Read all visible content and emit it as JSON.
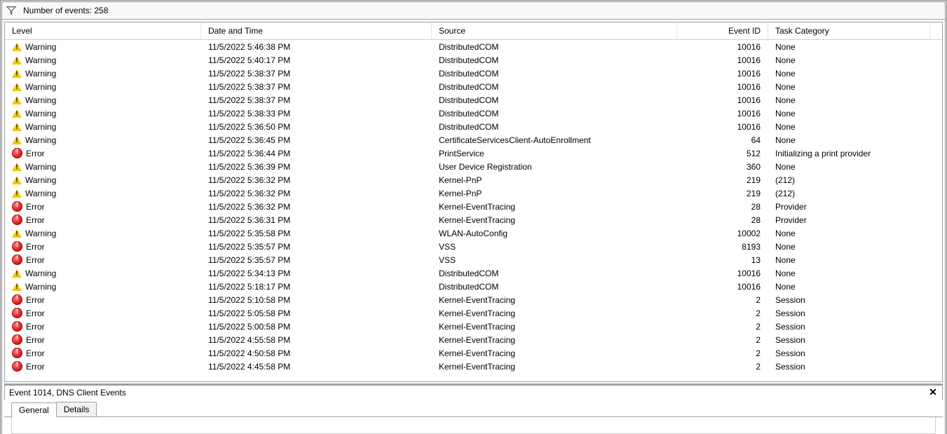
{
  "filter": {
    "label": "Number of events: 258"
  },
  "columns": {
    "level": "Level",
    "date": "Date and Time",
    "source": "Source",
    "id": "Event ID",
    "task": "Task Category"
  },
  "rows": [
    {
      "sev": "Warning",
      "date": "11/5/2022 5:46:38 PM",
      "source": "DistributedCOM",
      "id": "10016",
      "task": "None"
    },
    {
      "sev": "Warning",
      "date": "11/5/2022 5:40:17 PM",
      "source": "DistributedCOM",
      "id": "10016",
      "task": "None"
    },
    {
      "sev": "Warning",
      "date": "11/5/2022 5:38:37 PM",
      "source": "DistributedCOM",
      "id": "10016",
      "task": "None"
    },
    {
      "sev": "Warning",
      "date": "11/5/2022 5:38:37 PM",
      "source": "DistributedCOM",
      "id": "10016",
      "task": "None"
    },
    {
      "sev": "Warning",
      "date": "11/5/2022 5:38:37 PM",
      "source": "DistributedCOM",
      "id": "10016",
      "task": "None"
    },
    {
      "sev": "Warning",
      "date": "11/5/2022 5:38:33 PM",
      "source": "DistributedCOM",
      "id": "10016",
      "task": "None"
    },
    {
      "sev": "Warning",
      "date": "11/5/2022 5:36:50 PM",
      "source": "DistributedCOM",
      "id": "10016",
      "task": "None"
    },
    {
      "sev": "Warning",
      "date": "11/5/2022 5:36:45 PM",
      "source": "CertificateServicesClient-AutoEnrollment",
      "id": "64",
      "task": "None"
    },
    {
      "sev": "Error",
      "date": "11/5/2022 5:36:44 PM",
      "source": "PrintService",
      "id": "512",
      "task": "Initializing a print provider"
    },
    {
      "sev": "Warning",
      "date": "11/5/2022 5:36:39 PM",
      "source": "User Device Registration",
      "id": "360",
      "task": "None"
    },
    {
      "sev": "Warning",
      "date": "11/5/2022 5:36:32 PM",
      "source": "Kernel-PnP",
      "id": "219",
      "task": "(212)"
    },
    {
      "sev": "Warning",
      "date": "11/5/2022 5:36:32 PM",
      "source": "Kernel-PnP",
      "id": "219",
      "task": "(212)"
    },
    {
      "sev": "Error",
      "date": "11/5/2022 5:36:32 PM",
      "source": "Kernel-EventTracing",
      "id": "28",
      "task": "Provider"
    },
    {
      "sev": "Error",
      "date": "11/5/2022 5:36:31 PM",
      "source": "Kernel-EventTracing",
      "id": "28",
      "task": "Provider"
    },
    {
      "sev": "Warning",
      "date": "11/5/2022 5:35:58 PM",
      "source": "WLAN-AutoConfig",
      "id": "10002",
      "task": "None"
    },
    {
      "sev": "Error",
      "date": "11/5/2022 5:35:57 PM",
      "source": "VSS",
      "id": "8193",
      "task": "None"
    },
    {
      "sev": "Error",
      "date": "11/5/2022 5:35:57 PM",
      "source": "VSS",
      "id": "13",
      "task": "None"
    },
    {
      "sev": "Warning",
      "date": "11/5/2022 5:34:13 PM",
      "source": "DistributedCOM",
      "id": "10016",
      "task": "None"
    },
    {
      "sev": "Warning",
      "date": "11/5/2022 5:18:17 PM",
      "source": "DistributedCOM",
      "id": "10016",
      "task": "None"
    },
    {
      "sev": "Error",
      "date": "11/5/2022 5:10:58 PM",
      "source": "Kernel-EventTracing",
      "id": "2",
      "task": "Session"
    },
    {
      "sev": "Error",
      "date": "11/5/2022 5:05:58 PM",
      "source": "Kernel-EventTracing",
      "id": "2",
      "task": "Session"
    },
    {
      "sev": "Error",
      "date": "11/5/2022 5:00:58 PM",
      "source": "Kernel-EventTracing",
      "id": "2",
      "task": "Session"
    },
    {
      "sev": "Error",
      "date": "11/5/2022 4:55:58 PM",
      "source": "Kernel-EventTracing",
      "id": "2",
      "task": "Session"
    },
    {
      "sev": "Error",
      "date": "11/5/2022 4:50:58 PM",
      "source": "Kernel-EventTracing",
      "id": "2",
      "task": "Session"
    },
    {
      "sev": "Error",
      "date": "11/5/2022 4:45:58 PM",
      "source": "Kernel-EventTracing",
      "id": "2",
      "task": "Session"
    }
  ],
  "details": {
    "title": "Event 1014, DNS Client Events",
    "tabs": {
      "general": "General",
      "details": "Details"
    }
  }
}
